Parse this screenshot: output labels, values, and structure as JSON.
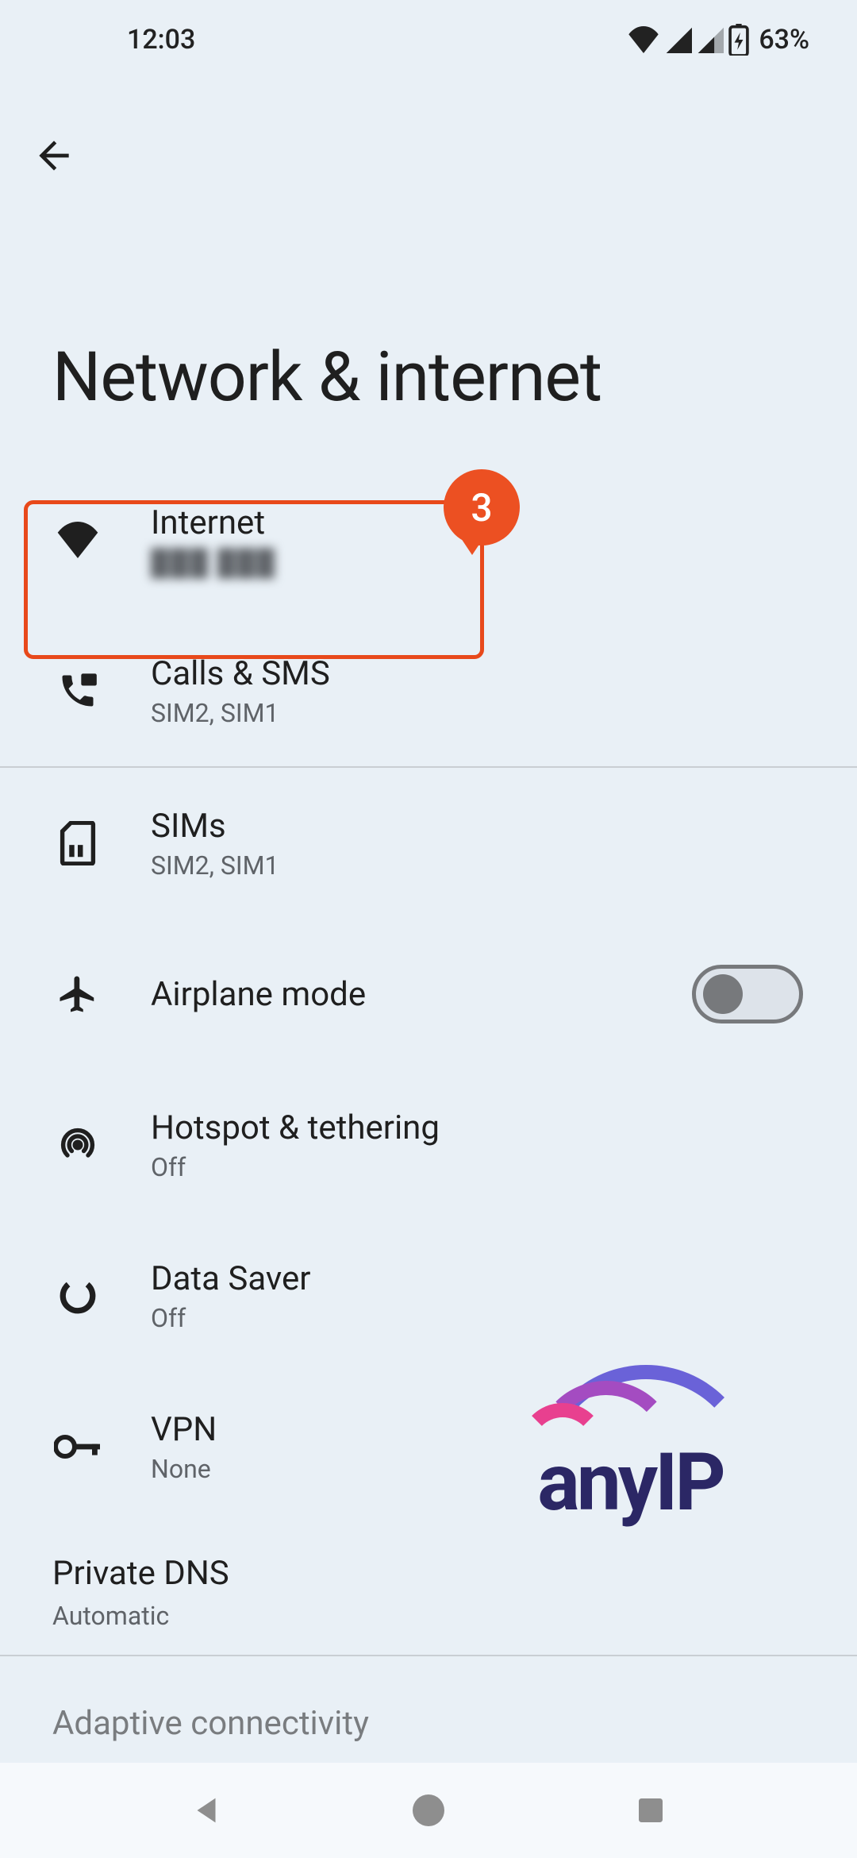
{
  "status": {
    "time": "12:03",
    "battery_pct": "63%"
  },
  "page": {
    "title": "Network & internet"
  },
  "annotation": {
    "badge": "3"
  },
  "items": {
    "internet": {
      "title": "Internet",
      "sub_obscured": "███ ███"
    },
    "calls": {
      "title": "Calls & SMS",
      "sub": "SIM2, SIM1"
    },
    "sims": {
      "title": "SIMs",
      "sub": "SIM2, SIM1"
    },
    "airplane": {
      "title": "Airplane mode"
    },
    "hotspot": {
      "title": "Hotspot & tethering",
      "sub": "Off"
    },
    "datasaver": {
      "title": "Data Saver",
      "sub": "Off"
    },
    "vpn": {
      "title": "VPN",
      "sub": "None"
    },
    "privdns": {
      "title": "Private DNS",
      "sub": "Automatic"
    },
    "adaptive": {
      "title": "Adaptive connectivity"
    }
  },
  "watermark": {
    "text": "anyIP"
  }
}
